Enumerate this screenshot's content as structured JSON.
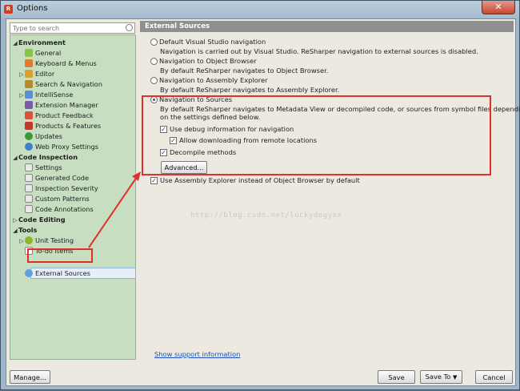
{
  "window": {
    "title": "Options",
    "app_icon_letter": "R"
  },
  "search": {
    "placeholder": "Type to search"
  },
  "tree": {
    "environment": {
      "label": "Environment",
      "items": [
        "General",
        "Keyboard & Menus",
        "Editor",
        "Search & Navigation",
        "IntelliSense",
        "Extension Manager",
        "Product Feedback",
        "Products & Features",
        "Updates",
        "Web Proxy Settings"
      ]
    },
    "code_inspection": {
      "label": "Code Inspection",
      "items": [
        "Settings",
        "Generated Code",
        "Inspection Severity",
        "Custom Patterns",
        "Code Annotations"
      ]
    },
    "code_editing": {
      "label": "Code Editing"
    },
    "tools": {
      "label": "Tools",
      "items": [
        "Unit Testing",
        "To-do Items",
        "External Sources"
      ]
    }
  },
  "pane": {
    "header": "External Sources",
    "options": [
      {
        "label": "Default Visual Studio navigation",
        "desc": "Navigation is carried out by Visual Studio. ReSharper navigation to external sources is disabled."
      },
      {
        "label": "Navigation to Object Browser",
        "desc": "By default ReSharper navigates to Object Browser."
      },
      {
        "label": "Navigation to Assembly Explorer",
        "desc": "By default ReSharper navigates to Assembly Explorer."
      },
      {
        "label": "Navigation to Sources",
        "desc": "By default ReSharper navigates to Metadata View or decompiled code, or sources from symbol files depending",
        "desc2": "on the settings defined below."
      }
    ],
    "checks": {
      "debug_info": "Use debug information for navigation",
      "remote": "Allow downloading from remote locations",
      "decompile": "Decompile methods"
    },
    "advanced_button": "Advanced...",
    "assembly_explorer_check": "Use Assembly Explorer instead of Object Browser by default",
    "support_link": "Show support information",
    "watermark": "http://blog.csdn.net/luckydogyxx"
  },
  "footer": {
    "manage": "Manage...",
    "save": "Save",
    "save_to": "Save To",
    "cancel": "Cancel"
  },
  "colors": {
    "annotation": "#e0302a",
    "tree_bg": "#c7dfc0",
    "header_bg": "#8f8f8f"
  }
}
